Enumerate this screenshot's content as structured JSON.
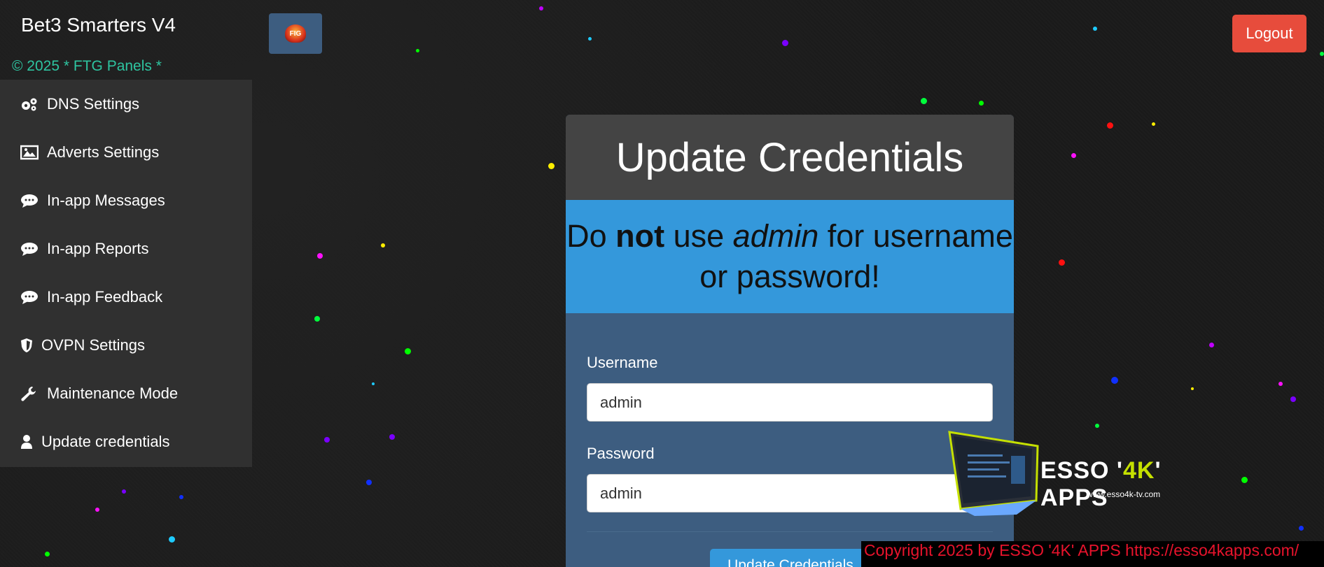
{
  "header": {
    "brand": "Bet3 Smarters V4",
    "fig_logo_text": "FIG",
    "copyright_small": "© 2025 * FTG Panels *",
    "logout_label": "Logout"
  },
  "sidebar": {
    "items": [
      {
        "label": "DNS Settings",
        "icon": "gears-icon"
      },
      {
        "label": "Adverts Settings",
        "icon": "image-icon"
      },
      {
        "label": "In-app Messages",
        "icon": "chat-icon"
      },
      {
        "label": "In-app Reports",
        "icon": "chat-icon"
      },
      {
        "label": "In-app Feedback",
        "icon": "chat-icon"
      },
      {
        "label": "OVPN Settings",
        "icon": "shield-icon"
      },
      {
        "label": "Maintenance Mode",
        "icon": "wrench-icon"
      },
      {
        "label": "Update credentials",
        "icon": "user-icon"
      }
    ]
  },
  "card": {
    "title": "Update Credentials",
    "warning": {
      "pre": "Do ",
      "bold": "not",
      "mid": " use ",
      "italic": "admin",
      "post": " for username or password!"
    },
    "username_label": "Username",
    "username_value": "admin",
    "password_label": "Password",
    "password_value": "admin",
    "submit_label": "Update Credentials"
  },
  "watermark": {
    "text_pre": "ESSO '",
    "text_accent": "4K",
    "text_post": "' APPS",
    "url": "www.esso4k-tv.com"
  },
  "footer": {
    "text": "Copyright 2025  by ESSO '4K' APPS https://esso4kapps.com/"
  },
  "colors": {
    "logout": "#e74c3c",
    "accent_blue": "#3498db",
    "card_bg": "#3d5d80",
    "sidebar_bg": "#303030",
    "footer_text": "#e8132c"
  }
}
